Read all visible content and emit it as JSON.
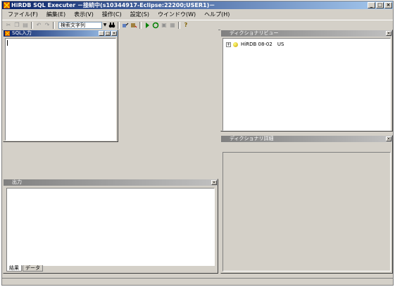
{
  "window": {
    "title": "HiRDB SQL Executer －接続中(s10344917-Eclipse:22200;USER1)－",
    "minimize": "_",
    "maximize": "□",
    "close": "×"
  },
  "menubar": {
    "items": [
      "ファイル(F)",
      "編集(E)",
      "表示(V)",
      "操作(C)",
      "設定(S)",
      "ウインドウ(W)",
      "ヘルプ(H)"
    ]
  },
  "toolbar": {
    "search_placeholder": "検索文字列",
    "dropdown_arrow": "▼"
  },
  "sql_input": {
    "title": "SQL入力",
    "minimize": "_",
    "maximize": "□",
    "close": "×"
  },
  "dictionary_view": {
    "title": "ディクショナリビュー",
    "pin": "×",
    "tree_expander": "+",
    "tree_root_label": "HiRDB 08-02　US"
  },
  "dictionary_details": {
    "title": "ディクショナリ詳細",
    "pin": "×"
  },
  "output": {
    "title": "出力",
    "pin": "×",
    "tabs": [
      "結果",
      "データ"
    ]
  }
}
